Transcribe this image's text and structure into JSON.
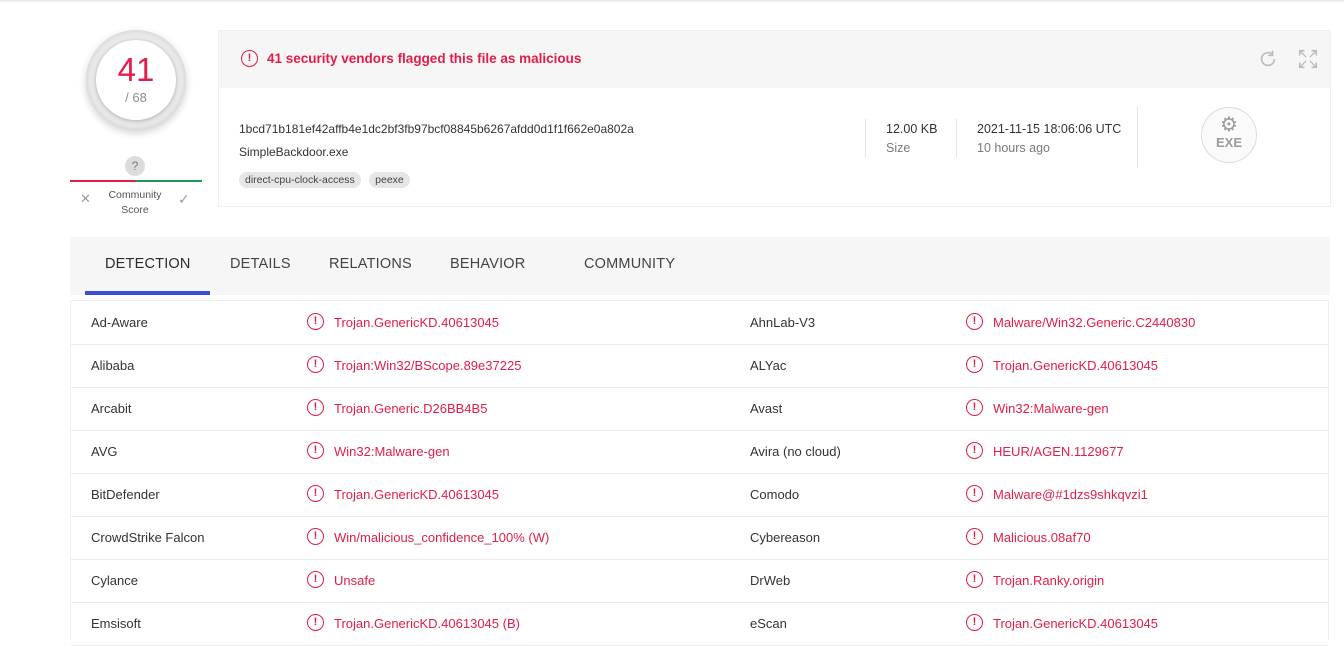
{
  "score": {
    "detections": "41",
    "total": "/ 68"
  },
  "community": {
    "unknown": "?",
    "label_line1": "Community",
    "label_line2": "Score",
    "dislike": "✕",
    "like": "✓"
  },
  "alert": {
    "icon": "!",
    "text": "41 security vendors flagged this file as malicious"
  },
  "file": {
    "hash": "1bcd71b181ef42affb4e1dc2bf3fb97bcf08845b6267afdd0d1f1f662e0a802a",
    "name": "SimpleBackdoor.exe",
    "tags": [
      "direct-cpu-clock-access",
      "peexe"
    ],
    "size_value": "12.00 KB",
    "size_label": "Size",
    "date": "2021-11-15 18:06:06 UTC",
    "date_relative": "10 hours ago",
    "type_badge": "EXE"
  },
  "icons": {
    "reload": "reload-icon",
    "expand": "expand-icon",
    "gears": "gears-icon",
    "alert": "exclamation-circle-icon"
  },
  "tabs": [
    "DETECTION",
    "DETAILS",
    "RELATIONS",
    "BEHAVIOR",
    "COMMUNITY"
  ],
  "active_tab": "DETECTION",
  "colors": {
    "malicious": "#e21d48",
    "clean": "#1c9a58",
    "accent": "#3a4fd9"
  },
  "detections": [
    {
      "left_vendor": "Ad-Aware",
      "left_result": "Trojan.GenericKD.40613045",
      "right_vendor": "AhnLab-V3",
      "right_result": "Malware/Win32.Generic.C2440830"
    },
    {
      "left_vendor": "Alibaba",
      "left_result": "Trojan:Win32/BScope.89e37225",
      "right_vendor": "ALYac",
      "right_result": "Trojan.GenericKD.40613045"
    },
    {
      "left_vendor": "Arcabit",
      "left_result": "Trojan.Generic.D26BB4B5",
      "right_vendor": "Avast",
      "right_result": "Win32:Malware-gen"
    },
    {
      "left_vendor": "AVG",
      "left_result": "Win32:Malware-gen",
      "right_vendor": "Avira (no cloud)",
      "right_result": "HEUR/AGEN.1129677"
    },
    {
      "left_vendor": "BitDefender",
      "left_result": "Trojan.GenericKD.40613045",
      "right_vendor": "Comodo",
      "right_result": "Malware@#1dzs9shkqvzi1"
    },
    {
      "left_vendor": "CrowdStrike Falcon",
      "left_result": "Win/malicious_confidence_100% (W)",
      "right_vendor": "Cybereason",
      "right_result": "Malicious.08af70"
    },
    {
      "left_vendor": "Cylance",
      "left_result": "Unsafe",
      "right_vendor": "DrWeb",
      "right_result": "Trojan.Ranky.origin"
    },
    {
      "left_vendor": "Emsisoft",
      "left_result": "Trojan.GenericKD.40613045 (B)",
      "right_vendor": "eScan",
      "right_result": "Trojan.GenericKD.40613045"
    }
  ]
}
